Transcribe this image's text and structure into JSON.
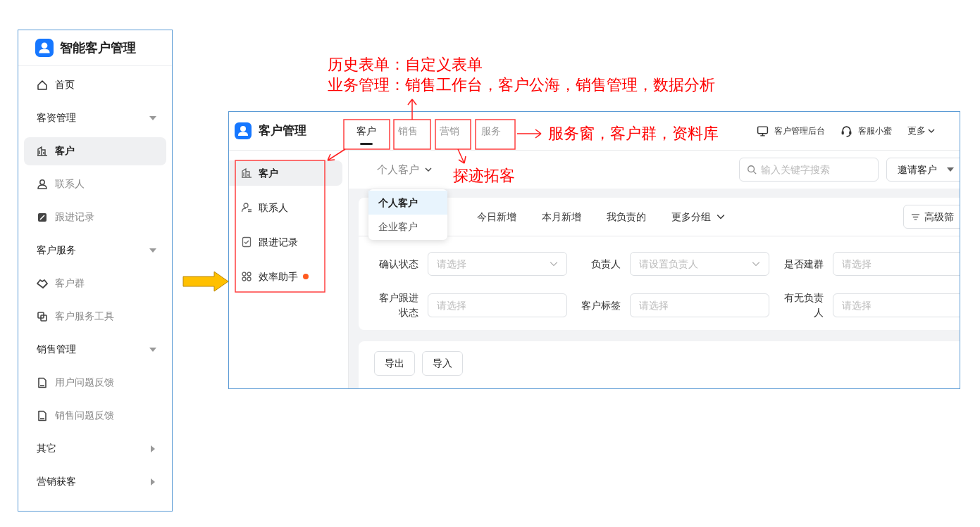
{
  "annotations": [
    {
      "text": "历史表单：自定义表单"
    },
    {
      "text": "业务管理：销售工作台，客户公海，销售管理，数据分析"
    },
    {
      "text": "服务窗，客户群，资料库"
    },
    {
      "text": "探迹拓客"
    }
  ],
  "left_app": {
    "title": "智能客户管理",
    "menu": [
      {
        "kind": "page",
        "label": "首页",
        "selected": false
      },
      {
        "kind": "section",
        "label": "客资管理",
        "expanded": true
      },
      {
        "kind": "item",
        "label": "客户",
        "selected": true
      },
      {
        "kind": "item",
        "label": "联系人",
        "selected": false
      },
      {
        "kind": "item",
        "label": "跟进记录",
        "selected": false
      },
      {
        "kind": "section",
        "label": "客户服务",
        "expanded": true
      },
      {
        "kind": "item",
        "label": "客户群",
        "selected": false
      },
      {
        "kind": "item",
        "label": "客户服务工具",
        "selected": false
      },
      {
        "kind": "section",
        "label": "销售管理",
        "expanded": true
      },
      {
        "kind": "item",
        "label": "用户问题反馈",
        "selected": false
      },
      {
        "kind": "item",
        "label": "销售问题反馈",
        "selected": false
      },
      {
        "kind": "section",
        "label": "其它",
        "expanded": false
      },
      {
        "kind": "section",
        "label": "营销获客",
        "expanded": false
      }
    ]
  },
  "right_app": {
    "title": "客户管理",
    "tabs": [
      {
        "label": "客户",
        "selected": true
      },
      {
        "label": "销售",
        "selected": false
      },
      {
        "label": "营销",
        "selected": false
      },
      {
        "label": "服务",
        "selected": false
      }
    ],
    "header_links": [
      {
        "label": "客户管理后台"
      },
      {
        "label": "客服小蜜"
      }
    ],
    "more": "更多",
    "sidebar": [
      {
        "label": "客户",
        "selected": true,
        "badge": false
      },
      {
        "label": "联系人",
        "selected": false,
        "badge": false
      },
      {
        "label": "跟进记录",
        "selected": false,
        "badge": false
      },
      {
        "label": "效率助手",
        "selected": false,
        "badge": true
      }
    ],
    "customer_type": "个人客户",
    "search": {
      "placeholder": "输入关键字搜索"
    },
    "invite_button": "邀请客户",
    "type_menu": [
      {
        "label": "个人客户",
        "selected": true
      },
      {
        "label": "企业客户",
        "selected": false
      }
    ],
    "groups": [
      {
        "label": "今日新增"
      },
      {
        "label": "本月新增"
      },
      {
        "label": "我负责的"
      }
    ],
    "more_groups": "更多分组",
    "advanced_filter": "高级筛",
    "filters": [
      {
        "label": "确认状态",
        "placeholder": "请选择",
        "kind": "select"
      },
      {
        "label": "负责人",
        "placeholder": "请设置负责人",
        "kind": "select"
      },
      {
        "label": "是否建群",
        "placeholder": "请选择",
        "kind": "input"
      },
      {
        "label": "客户跟进状态",
        "placeholder": "请选择",
        "kind": "input"
      },
      {
        "label": "客户标签",
        "placeholder": "请选择",
        "kind": "input"
      },
      {
        "label": "有无负责人",
        "placeholder": "请选择",
        "kind": "input"
      }
    ],
    "actions": [
      {
        "label": "导出"
      },
      {
        "label": "导入"
      }
    ]
  }
}
